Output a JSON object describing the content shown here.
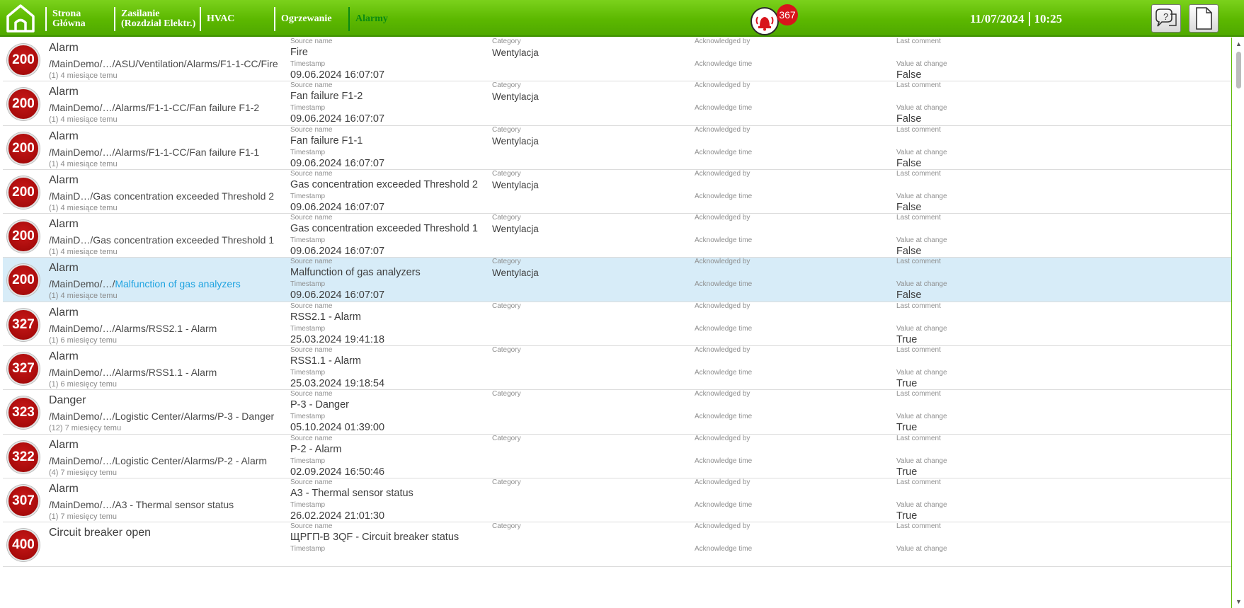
{
  "nav": {
    "items": [
      {
        "label": "Strona\nGłówna"
      },
      {
        "label": "Zasilanie\n(Rozdział Elektr.)"
      },
      {
        "label": "HVAC"
      },
      {
        "label": "Ogrzewanie"
      },
      {
        "label": "Alarmy"
      }
    ],
    "active": "Alarmy",
    "alarm_count": "367",
    "date": "11/07/2024",
    "time": "10:25"
  },
  "colors": {
    "topbar": "#5cb800",
    "active_nav": "#0a8a12",
    "priority_badge": "#b00d0d",
    "selected_row": "#d7ecf8",
    "link": "#1fa3e0"
  },
  "labels": {
    "source_name": "Source name",
    "timestamp": "Timestamp",
    "category": "Category",
    "acknowledged_by": "Acknowledged by",
    "acknowledge_time": "Acknowledge time",
    "last_comment": "Last comment",
    "value_at_change": "Value at change"
  },
  "alarms": [
    {
      "priority": "200",
      "title": "Alarm",
      "path": "/MainDemo/…/ASU/Ventilation/Alarms/F1-1-CC/Fire",
      "age": "(1) 4 miesiące temu",
      "source": "Fire",
      "timestamp": "09.06.2024 16:07:07",
      "category": "Wentylacja",
      "value": "False"
    },
    {
      "priority": "200",
      "title": "Alarm",
      "path": "/MainDemo/…/Alarms/F1-1-CC/Fan failure F1-2",
      "age": "(1) 4 miesiące temu",
      "source": "Fan failure F1-2",
      "timestamp": "09.06.2024 16:07:07",
      "category": "Wentylacja",
      "value": "False"
    },
    {
      "priority": "200",
      "title": "Alarm",
      "path": "/MainDemo/…/Alarms/F1-1-CC/Fan failure F1-1",
      "age": "(1) 4 miesiące temu",
      "source": "Fan failure F1-1",
      "timestamp": "09.06.2024 16:07:07",
      "category": "Wentylacja",
      "value": "False"
    },
    {
      "priority": "200",
      "title": "Alarm",
      "path": "/MainD…/Gas concentration exceeded Threshold 2",
      "age": "(1) 4 miesiące temu",
      "source": "Gas concentration exceeded Threshold 2",
      "timestamp": "09.06.2024 16:07:07",
      "category": "Wentylacja",
      "value": "False"
    },
    {
      "priority": "200",
      "title": "Alarm",
      "path": "/MainD…/Gas concentration exceeded Threshold 1",
      "age": "(1) 4 miesiące temu",
      "source": "Gas concentration exceeded Threshold 1",
      "timestamp": "09.06.2024 16:07:07",
      "category": "Wentylacja",
      "value": "False"
    },
    {
      "priority": "200",
      "title": "Alarm",
      "path_prefix": "/MainDemo/…/",
      "path_link": "Malfunction of gas analyzers",
      "age": "(1) 4 miesiące temu",
      "source": "Malfunction of gas analyzers",
      "timestamp": "09.06.2024 16:07:07",
      "category": "Wentylacja",
      "value": "False",
      "selected": true
    },
    {
      "priority": "327",
      "title": "Alarm",
      "path": "/MainDemo/…/Alarms/RSS2.1 - Alarm",
      "age": "(1) 6 miesięcy temu",
      "source": "RSS2.1 - Alarm",
      "timestamp": "25.03.2024 19:41:18",
      "category": "",
      "value": "True"
    },
    {
      "priority": "327",
      "title": "Alarm",
      "path": "/MainDemo/…/Alarms/RSS1.1 - Alarm",
      "age": "(1) 6 miesięcy temu",
      "source": "RSS1.1 - Alarm",
      "timestamp": "25.03.2024 19:18:54",
      "category": "",
      "value": "True"
    },
    {
      "priority": "323",
      "title": "Danger",
      "path": "/MainDemo/…/Logistic Center/Alarms/P-3 - Danger",
      "age": "(12) 7 miesięcy temu",
      "source": "P-3 - Danger",
      "timestamp": "05.10.2024 01:39:00",
      "category": "",
      "value": "True"
    },
    {
      "priority": "322",
      "title": "Alarm",
      "path": "/MainDemo/…/Logistic Center/Alarms/P-2 - Alarm",
      "age": "(4) 7 miesięcy temu",
      "source": "P-2 - Alarm",
      "timestamp": "02.09.2024 16:50:46",
      "category": "",
      "value": "True"
    },
    {
      "priority": "307",
      "title": "Alarm",
      "path": "/MainDemo/…/A3 - Thermal sensor status",
      "age": "(1) 7 miesięcy temu",
      "source": "A3 - Thermal sensor status",
      "timestamp": "26.02.2024 21:01:30",
      "category": "",
      "value": "True"
    },
    {
      "priority": "400",
      "title": "Circuit breaker open",
      "path": "",
      "age": "",
      "source": "ЩРГП-В 3QF - Circuit breaker status",
      "timestamp": "",
      "category": "",
      "value": ""
    }
  ]
}
